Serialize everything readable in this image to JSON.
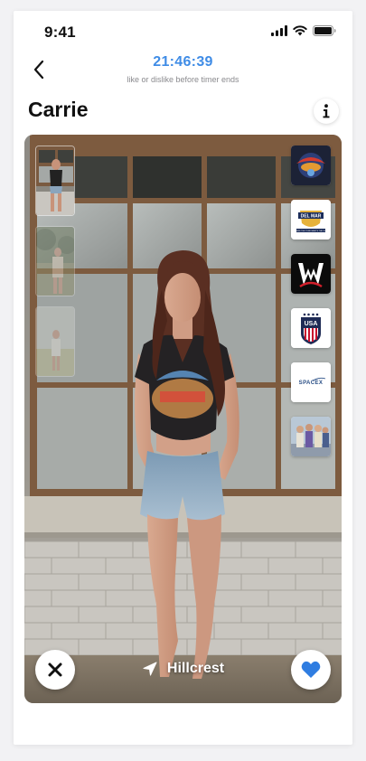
{
  "status_bar": {
    "time": "9:41"
  },
  "header": {
    "timer": "21:46:39",
    "timer_caption": "like or dislike before timer ends"
  },
  "profile": {
    "name": "Carrie",
    "location": "Hillcrest"
  },
  "badges": [
    {
      "icon": "journey-band-logo"
    },
    {
      "icon": "del-mar-logo"
    },
    {
      "icon": "wwe-logo"
    },
    {
      "icon": "usa-soccer-logo"
    },
    {
      "icon": "spacex-logo"
    },
    {
      "icon": "group-photo"
    }
  ],
  "badge_text": {
    "del_mar_top": "DEL MAR",
    "del_mar_bottom": "WHERE THE TURF MEETS THE SURF",
    "wwe": "W",
    "usa": "USA",
    "spacex": "SPACEX"
  },
  "colors": {
    "accent": "#3f8ce6",
    "like": "#2f7de1"
  }
}
